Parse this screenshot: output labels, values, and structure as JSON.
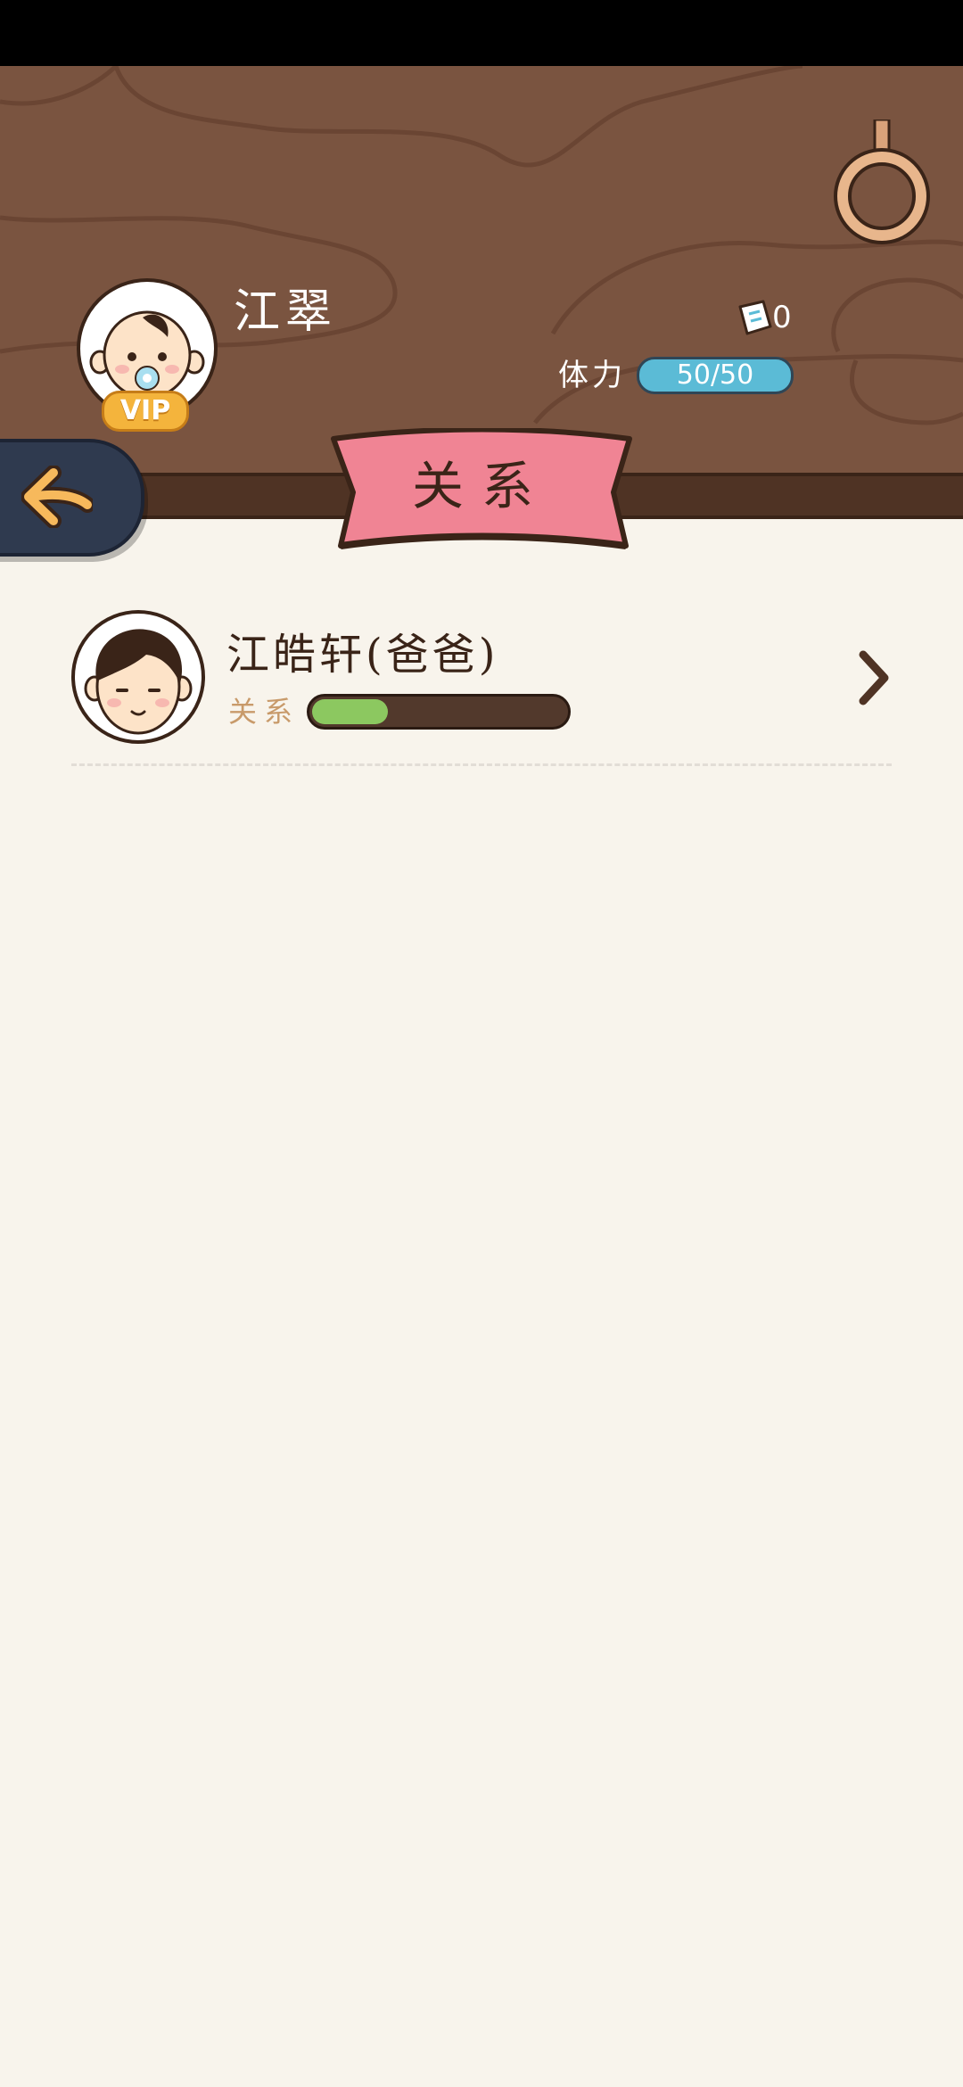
{
  "header": {
    "player_name": "江翠",
    "vip_label": "VIP",
    "ticket_count": "0",
    "stamina_label": "体力",
    "stamina_value": "50/50"
  },
  "title_banner": {
    "title": "关系"
  },
  "relations": [
    {
      "name": "江皓轩(爸爸)",
      "relation_label": "关系",
      "relation_level": 0.3
    }
  ],
  "icons": {
    "back": "back-arrow-icon",
    "ring": "hanging-ring-icon",
    "ticket": "ticket-icon",
    "chevron": "chevron-right-icon"
  },
  "colors": {
    "wood": "#7a5440",
    "banner": "#f08494",
    "stamina_bar": "#5bbbd6",
    "relation_fill": "#8cc860",
    "back_button": "#2f3a4f"
  }
}
